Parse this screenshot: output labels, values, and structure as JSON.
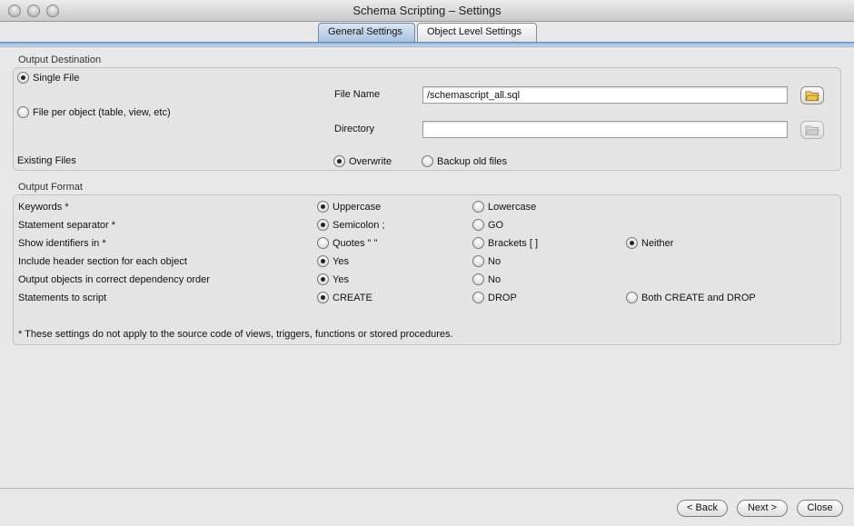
{
  "window": {
    "title": "Schema Scripting – Settings"
  },
  "tabs": [
    {
      "label": "General Settings",
      "active": true
    },
    {
      "label": "Object Level Settings",
      "active": false
    }
  ],
  "output_destination": {
    "title": "Output Destination",
    "single_file": {
      "label": "Single File",
      "selected": true
    },
    "file_per_object": {
      "label": "File per object (table, view, etc)",
      "selected": false
    },
    "file_name": {
      "label": "File Name",
      "value": "/schemascript_all.sql"
    },
    "directory": {
      "label": "Directory",
      "value": ""
    },
    "existing_files": {
      "label": "Existing Files",
      "overwrite": {
        "label": "Overwrite",
        "selected": true
      },
      "backup": {
        "label": "Backup old files",
        "selected": false
      }
    }
  },
  "output_format": {
    "title": "Output Format",
    "rows": [
      {
        "label": "Keywords *",
        "options": [
          {
            "label": "Uppercase",
            "selected": true
          },
          {
            "label": "Lowercase",
            "selected": false
          }
        ]
      },
      {
        "label": "Statement separator *",
        "options": [
          {
            "label": "Semicolon ;",
            "selected": true
          },
          {
            "label": "GO",
            "selected": false
          }
        ]
      },
      {
        "label": "Show identifiers in *",
        "options": [
          {
            "label": "Quotes \" \"",
            "selected": false
          },
          {
            "label": "Brackets [ ]",
            "selected": false
          },
          {
            "label": "Neither",
            "selected": true
          }
        ]
      },
      {
        "label": "Include header section for each object",
        "options": [
          {
            "label": "Yes",
            "selected": true
          },
          {
            "label": "No",
            "selected": false
          }
        ]
      },
      {
        "label": "Output objects in correct dependency order",
        "options": [
          {
            "label": "Yes",
            "selected": true
          },
          {
            "label": "No",
            "selected": false
          }
        ]
      },
      {
        "label": "Statements to script",
        "options": [
          {
            "label": "CREATE",
            "selected": true
          },
          {
            "label": "DROP",
            "selected": false
          },
          {
            "label": "Both CREATE and DROP",
            "selected": false
          }
        ]
      }
    ],
    "note": "* These settings do not apply to the source code of views, triggers, functions or stored procedures."
  },
  "buttons": {
    "back": "< Back",
    "next": "Next >",
    "close": "Close"
  },
  "icons": {
    "browse_file": "folder-open-icon",
    "browse_directory": "folder-icon"
  },
  "colors": {
    "tab_active": "#a9c3e0",
    "tab_rule": "#8fb0d6",
    "folder": "#f2c14e"
  }
}
